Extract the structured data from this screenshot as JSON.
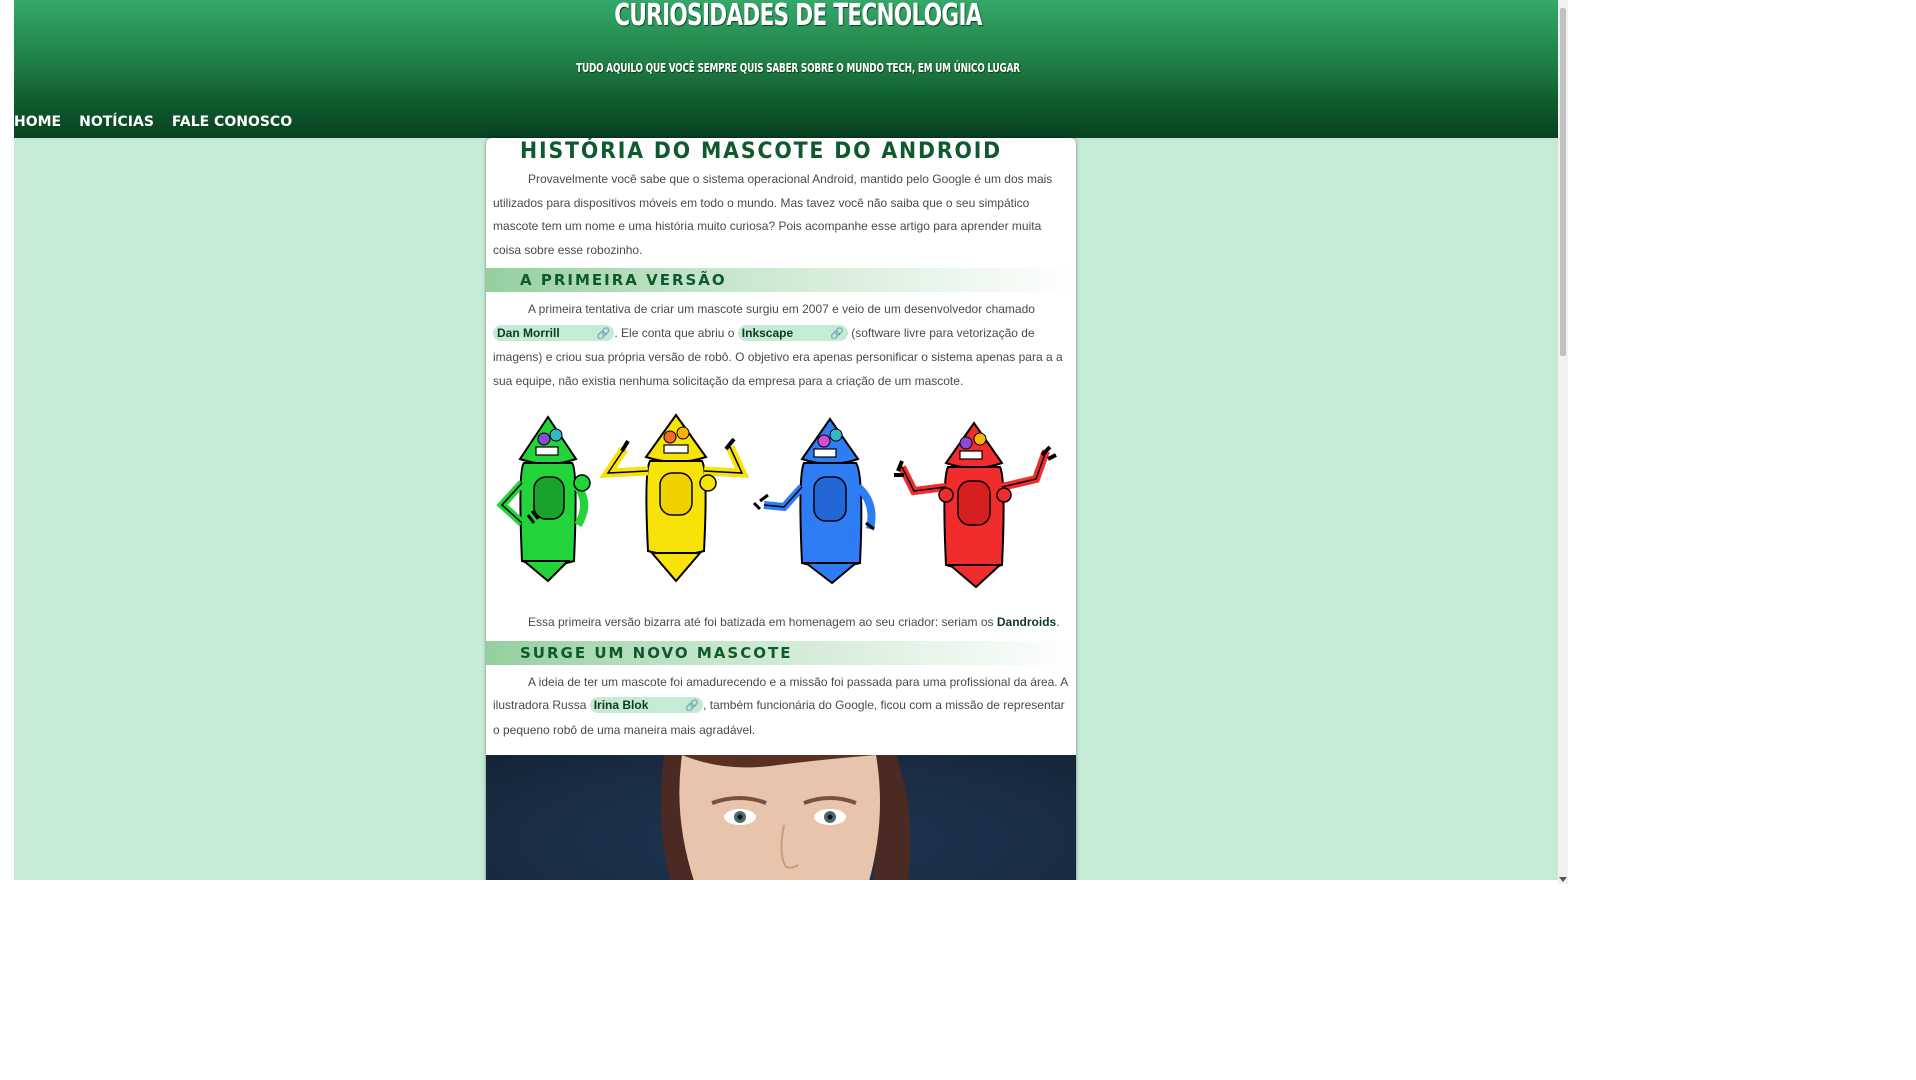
{
  "header": {
    "title": "Curiosidades de Tecnologia",
    "subtitle": "Tudo aquilo que você sempre quis saber sobre o mundo tech, em um único lugar"
  },
  "nav": {
    "items": [
      "HOME",
      "NOTÍCIAS",
      "FALE CONOSCO"
    ]
  },
  "article": {
    "title": "História do mascote do Android",
    "intro": "Provavelmente você sabe que o sistema operacional Android, mantido pelo Google é um dos mais utilizados para dispositivos móveis em todo o mundo. Mas tavez você não saiba que o seu simpático mascote tem um nome e uma história muito curiosa? Pois acompanhe esse artigo para aprender muita coisa sobre esse robozinho.",
    "section1": {
      "heading": "A primeira versão",
      "p1_a": "A primeira tentativa de criar um mascote surgiu em 2007 e veio de um desenvolvedor chamado ",
      "link1": "Dan Morrill",
      "p1_b": ". Ele conta que abriu o ",
      "link2": "Inkscape",
      "p1_c": " (software livre para vetorização de imagens) e criou sua própria versão de robô. O objetivo era apenas personificar o sistema apenas para a a sua equipe, não existia nenhuma solicitação da empresa para a criação de um mascote.",
      "p2_a": "Essa primeira versão bizarra até foi batizada em homenagem ao seu criador: seriam os ",
      "p2_bold": "Dandroids",
      "p2_c": "."
    },
    "section2": {
      "heading": "Surge um novo mascote",
      "p1_a": "A ideia de ter um mascote foi amadurecendo e a missão foi passada para uma profissional da área. A ilustradora Russa ",
      "link": "Irina Blok",
      "p1_b": ", também funcionária do Google, ficou com a missão de representar o pequeno robô de uma maneira mais agradável."
    },
    "link_icon": "🔗"
  },
  "colors": {
    "page_bg": "#c5ead6",
    "header_top": "#35a86a",
    "header_bottom": "#094021",
    "title_green": "#0e5a2c",
    "robot_green": "#22d33a",
    "robot_yellow": "#f7e20a",
    "robot_blue": "#2f7df5",
    "robot_red": "#f02c2c"
  }
}
